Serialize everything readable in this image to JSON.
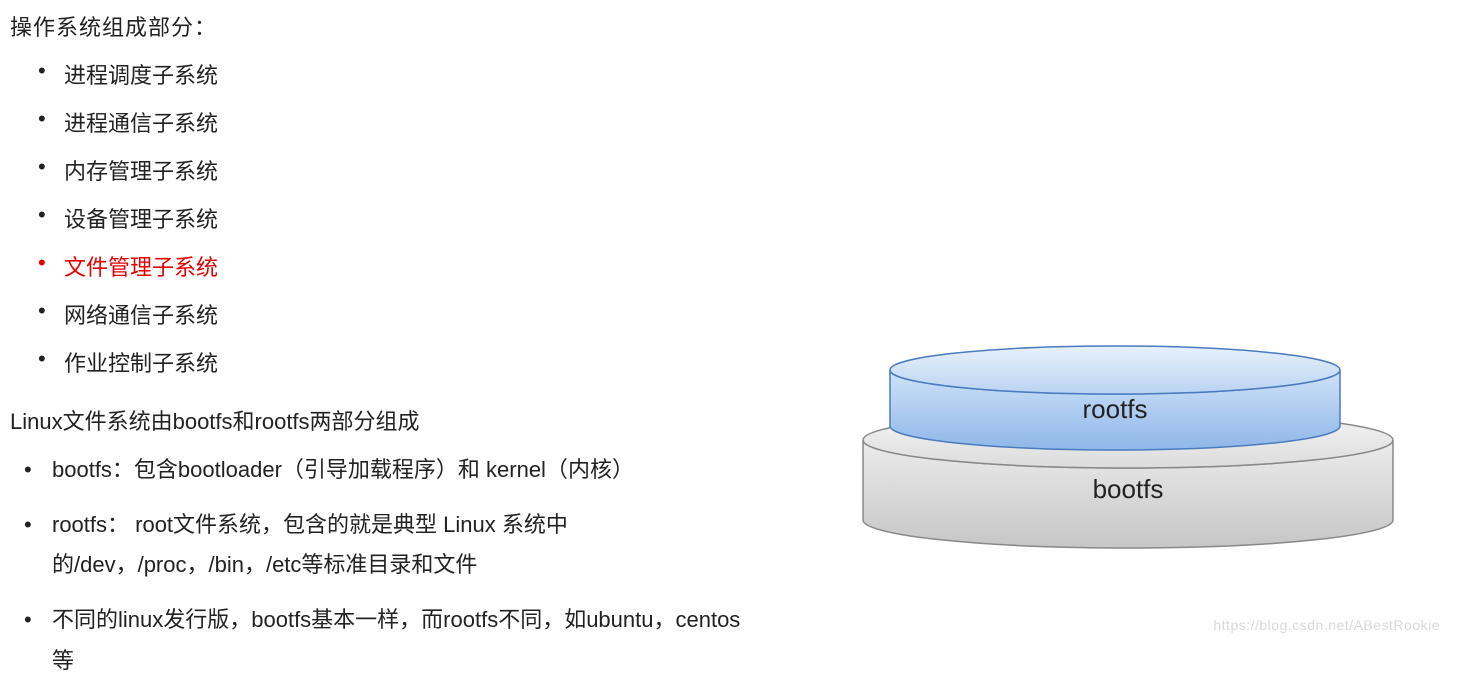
{
  "title": "操作系统组成部分：",
  "os_components": [
    {
      "label": "进程调度子系统",
      "highlight": false
    },
    {
      "label": "进程通信子系统",
      "highlight": false
    },
    {
      "label": "内存管理子系统",
      "highlight": false
    },
    {
      "label": "设备管理子系统",
      "highlight": false
    },
    {
      "label": "文件管理子系统",
      "highlight": true
    },
    {
      "label": "网络通信子系统",
      "highlight": false
    },
    {
      "label": "作业控制子系统",
      "highlight": false
    }
  ],
  "fs_heading": "Linux文件系统由bootfs和rootfs两部分组成",
  "fs_items": [
    "bootfs：包含bootloader（引导加载程序）和 kernel（内核）",
    "rootfs： root文件系统，包含的就是典型 Linux 系统中的/dev，/proc，/bin，/etc等标准目录和文件",
    "不同的linux发行版，bootfs基本一样，而rootfs不同，如ubuntu，centos等"
  ],
  "diagram": {
    "top_label": "rootfs",
    "bottom_label": "bootfs",
    "top_fill": "#a7c7f0",
    "top_stroke": "#4a7bbf",
    "bottom_fill": "#d6d6d6",
    "bottom_stroke": "#888888"
  },
  "watermark": "https://blog.csdn.net/ABestRookie"
}
